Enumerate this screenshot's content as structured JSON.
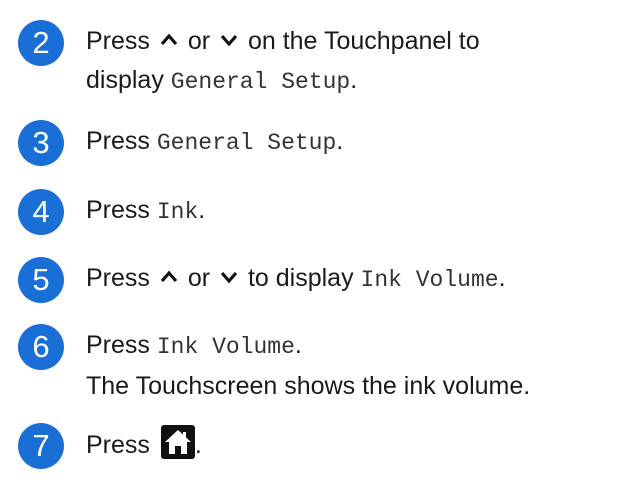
{
  "steps": [
    {
      "number": "2",
      "press": "Press",
      "or": "or",
      "tail": "on the Touchpanel to",
      "line2_prefix": "display",
      "code": "General Setup",
      "period": "."
    },
    {
      "number": "3",
      "press": "Press",
      "code": "General Setup",
      "period": "."
    },
    {
      "number": "4",
      "press": "Press",
      "code": "Ink",
      "period": "."
    },
    {
      "number": "5",
      "press": "Press",
      "or": "or",
      "tail": "to display",
      "code": "Ink Volume",
      "period": "."
    },
    {
      "number": "6",
      "press": "Press",
      "code": "Ink Volume",
      "period": ".",
      "line2": "The Touchscreen shows the ink volume."
    },
    {
      "number": "7",
      "press": "Press",
      "period": "."
    }
  ],
  "icons": {
    "up": "chevron-up-icon",
    "down": "chevron-down-icon",
    "home": "home-icon"
  },
  "colors": {
    "badge": "#1a6fd6"
  }
}
